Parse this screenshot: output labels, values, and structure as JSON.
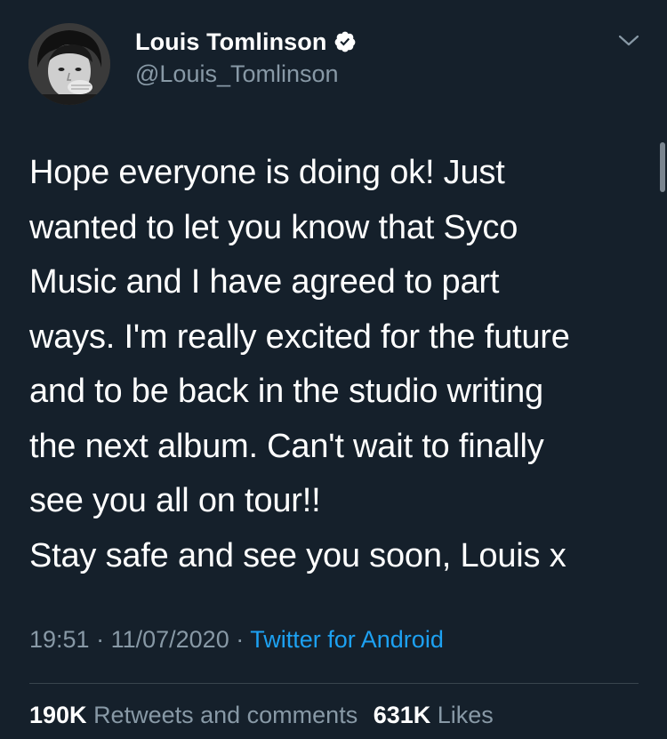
{
  "user": {
    "display_name": "Louis Tomlinson",
    "handle": "@Louis_Tomlinson",
    "verified": true
  },
  "tweet": {
    "text": "Hope everyone is doing ok! Just\nwanted to let you know that Syco\nMusic and I have agreed to part\nways. I'm really excited for the future\nand to be back in the studio writing\nthe next album. Can't wait to finally\nsee you all on tour!!\nStay safe and see you soon, Louis x",
    "time": "19:51",
    "separator": " · ",
    "date": "11/07/2020",
    "source": "Twitter for Android"
  },
  "stats": {
    "retweets_count": "190K",
    "retweets_label": "Retweets and comments",
    "likes_count": "631K",
    "likes_label": "Likes"
  },
  "icons": {
    "verified": "verified-badge-icon",
    "menu": "chevron-down-icon"
  },
  "colors": {
    "background": "#15202b",
    "secondary_text": "#8899a6",
    "link": "#1da1f2",
    "divider": "#38444d"
  }
}
